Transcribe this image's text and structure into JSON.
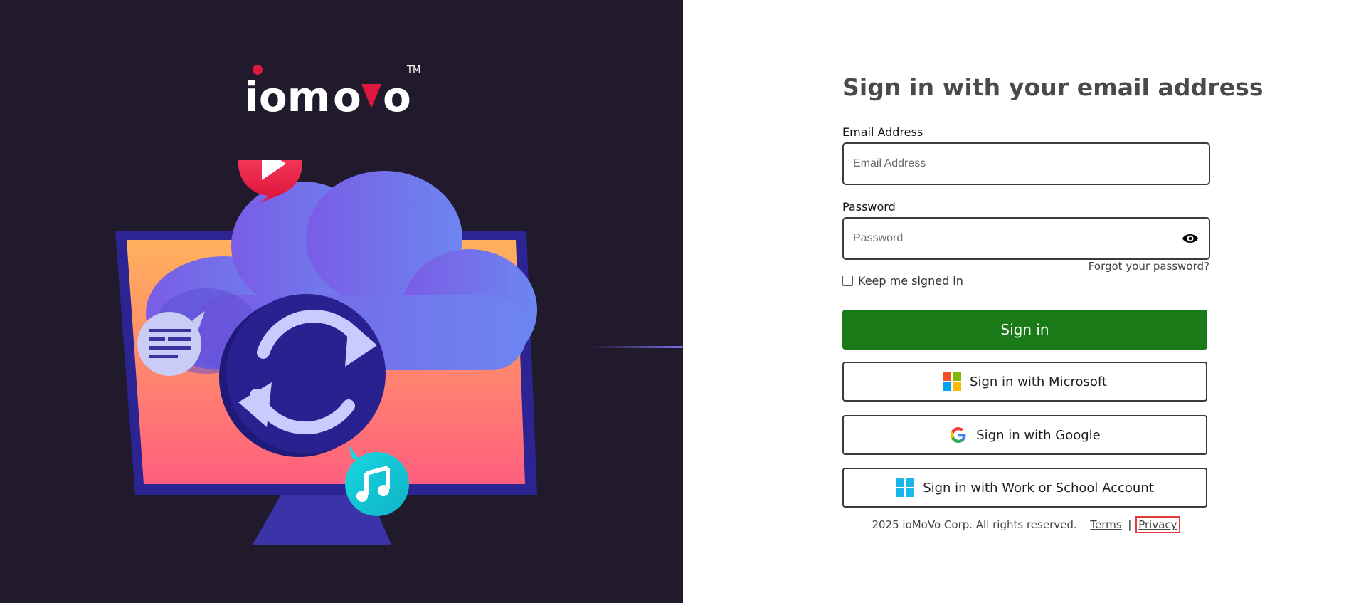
{
  "brand": {
    "logo_text": "iomovo",
    "trademark": "TM",
    "accent_color": "#e0173d"
  },
  "form": {
    "title": "Sign in with your email address",
    "email": {
      "label": "Email Address",
      "placeholder": "Email Address",
      "value": ""
    },
    "password": {
      "label": "Password",
      "placeholder": "Password",
      "value": "",
      "toggle_icon": "eye-icon"
    },
    "forgot_link": "Forgot your password?",
    "keep_signed_in": {
      "label": "Keep me signed in",
      "checked": false
    },
    "sign_in_button": "Sign in",
    "providers": [
      {
        "label": "Sign in with Microsoft",
        "icon": "microsoft-icon"
      },
      {
        "label": "Sign in with Google",
        "icon": "google-icon"
      },
      {
        "label": "Sign in with Work or School Account",
        "icon": "windows-icon"
      }
    ]
  },
  "footer": {
    "copyright": "2025 ioMoVo Corp. All rights reserved.",
    "terms": "Terms",
    "separator": "|",
    "privacy": "Privacy"
  },
  "colors": {
    "left_panel_bg": "#211a2c",
    "primary_button": "#1a7a18",
    "text": "#4a4a4a"
  }
}
